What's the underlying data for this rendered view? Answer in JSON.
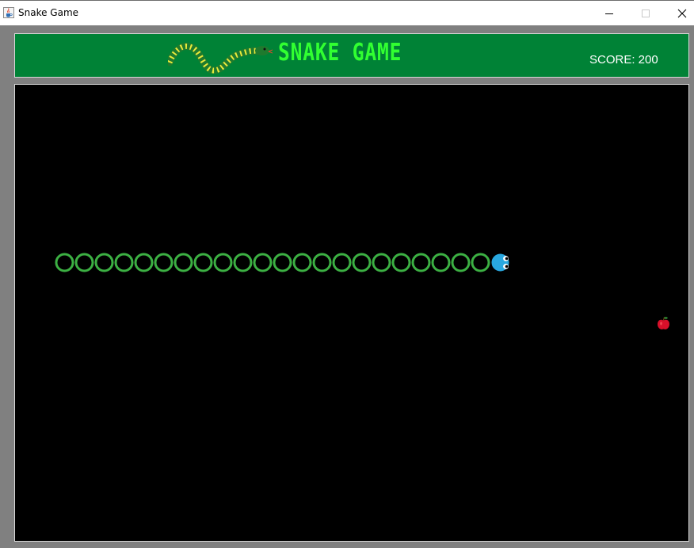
{
  "window": {
    "title": "Snake Game",
    "app_icon": "java-cup-icon",
    "controls": [
      "minimize-icon",
      "maximize-icon",
      "close-icon"
    ]
  },
  "header": {
    "logo_icon": "snake-logo-icon",
    "title": "SNAKE GAME",
    "score_text": "SCORE: 200",
    "background_color": "#008236",
    "title_color": "#31ff31"
  },
  "board": {
    "background_color": "#000000",
    "grid_unit": 25,
    "snake": {
      "direction": "right",
      "head_cell": [
        24,
        8
      ],
      "body_cells": [
        [
          23,
          8
        ],
        [
          22,
          8
        ],
        [
          21,
          8
        ],
        [
          20,
          8
        ],
        [
          19,
          8
        ],
        [
          18,
          8
        ],
        [
          17,
          8
        ],
        [
          16,
          8
        ],
        [
          15,
          8
        ],
        [
          14,
          8
        ],
        [
          13,
          8
        ],
        [
          12,
          8
        ],
        [
          11,
          8
        ],
        [
          10,
          8
        ],
        [
          9,
          8
        ],
        [
          8,
          8
        ],
        [
          7,
          8
        ],
        [
          6,
          8
        ],
        [
          5,
          8
        ],
        [
          4,
          8
        ],
        [
          3,
          8
        ],
        [
          2,
          8
        ]
      ],
      "body_color": "#3cb043",
      "head_color": "#29a8e0"
    },
    "food": {
      "type": "apple-icon",
      "cell": [
        32,
        11
      ],
      "color": "#d8102a"
    }
  }
}
